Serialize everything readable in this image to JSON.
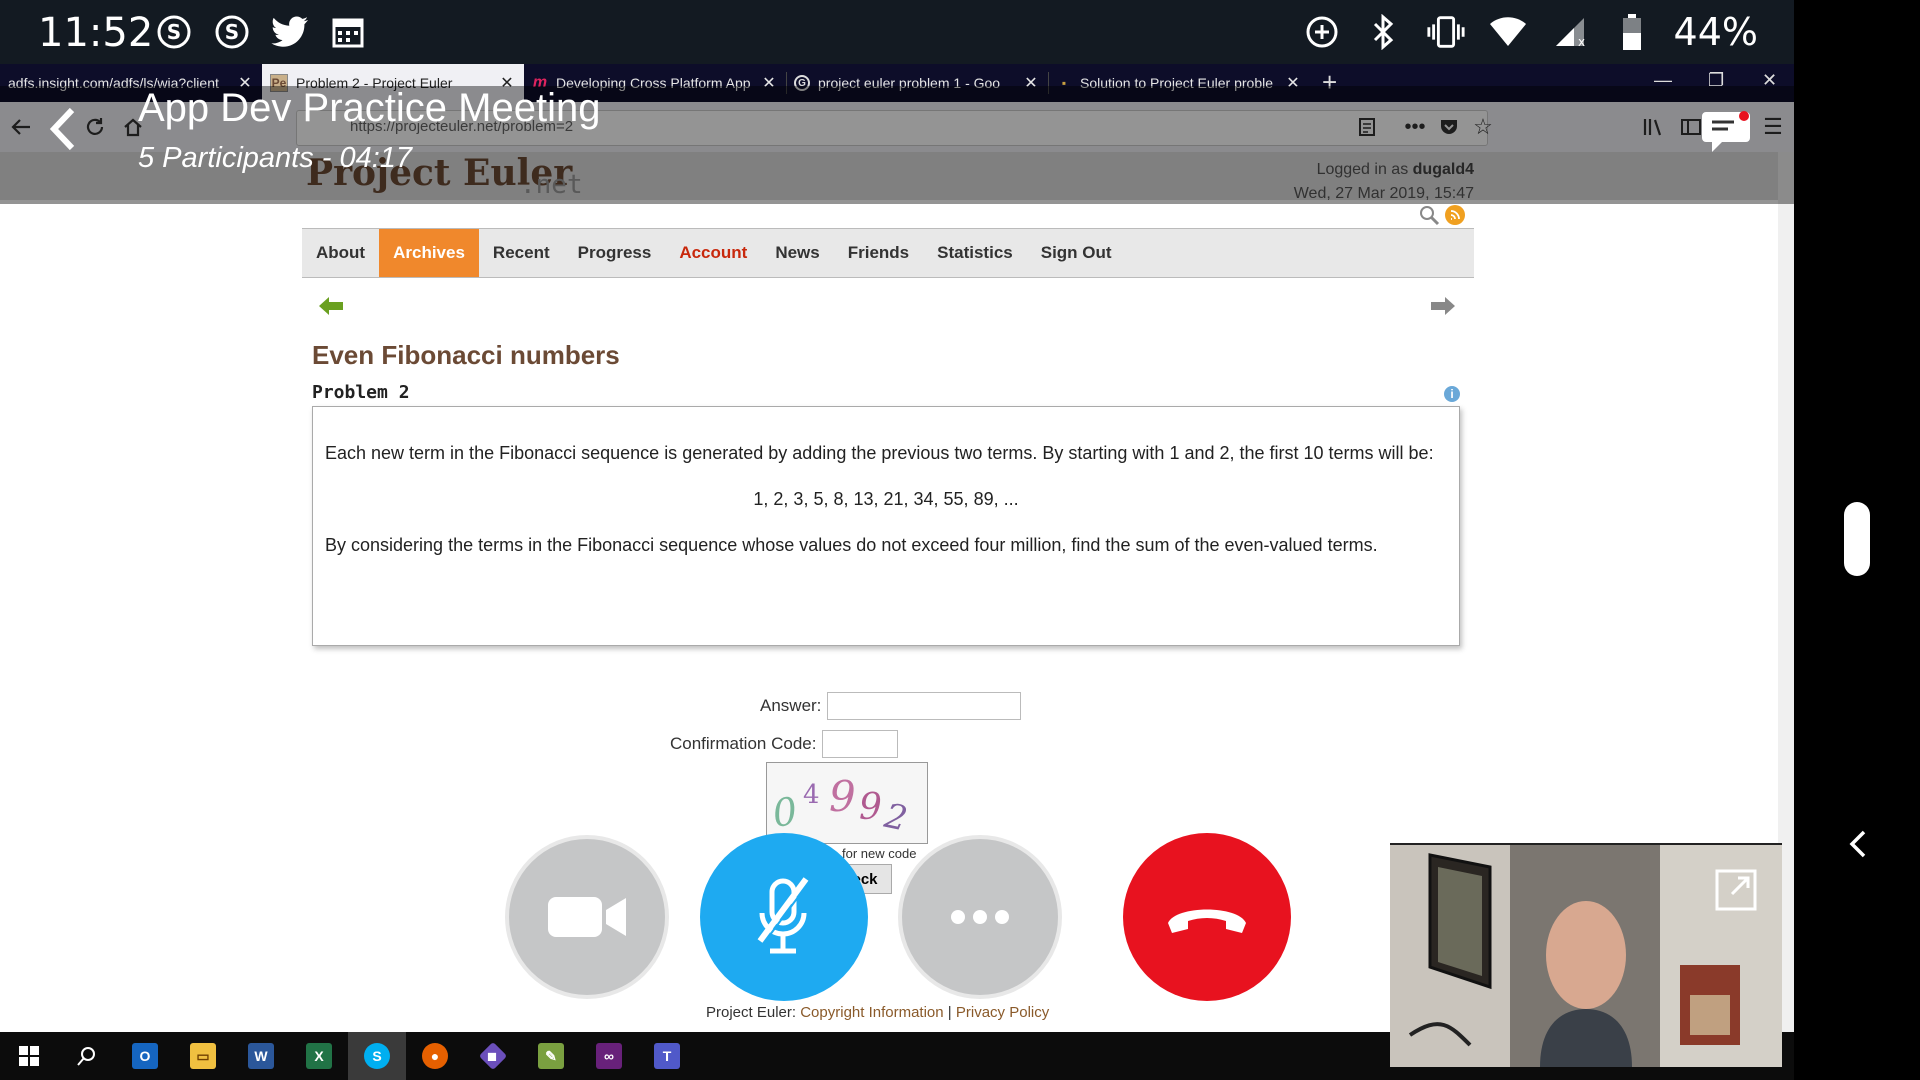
{
  "status_bar": {
    "time": "11:52",
    "battery": "44%",
    "left_icons": [
      "skype-icon",
      "skype-icon",
      "twitter-icon",
      "calendar-icon"
    ],
    "right_icons": [
      "data-saver-icon",
      "bluetooth-icon",
      "vibrate-icon",
      "wifi-icon",
      "signal-icon",
      "battery-icon"
    ]
  },
  "browser": {
    "tabs": [
      {
        "title": "adfs.insight.com/adfs/ls/wia?client",
        "icon": "none"
      },
      {
        "title": "Problem 2 - Project Euler",
        "icon": "project-euler-icon",
        "active": true
      },
      {
        "title": "Developing Cross Platform App",
        "icon": "m-icon"
      },
      {
        "title": "project euler problem 1 - Goo",
        "icon": "google-icon"
      },
      {
        "title": "Solution to Project Euler proble",
        "icon": "site-icon"
      }
    ],
    "url": "https://projecteuler.net/problem=2"
  },
  "page": {
    "logo": "Project Euler",
    "logo_suffix": ".net",
    "logged_in_prefix": "Logged in as",
    "username": "dugald4",
    "datetime": "Wed, 27 Mar 2019, 15:47",
    "nav": [
      "About",
      "Archives",
      "Recent",
      "Progress",
      "Account",
      "News",
      "Friends",
      "Statistics",
      "Sign Out"
    ],
    "active_nav": "Archives",
    "problem_title": "Even Fibonacci numbers",
    "problem_number": "Problem 2",
    "problem_text_1": "Each new term in the Fibonacci sequence is generated by adding the previous two terms. By starting with 1 and 2, the first 10 terms will be:",
    "problem_sequence": "1, 2, 3, 5, 8, 13, 21, 34, 55, 89, ...",
    "problem_text_2": "By considering the terms in the Fibonacci sequence whose values do not exceed four million, find the sum of the even-valued terms.",
    "answer_label": "Answer:",
    "confirmation_label": "Confirmation Code:",
    "captcha_text": "04992",
    "captcha_hint": "for new code",
    "check_label": "eck",
    "footer_prefix": "Project Euler:",
    "footer_copyright": "Copyright Information",
    "footer_sep": "|",
    "footer_privacy": "Privacy Policy"
  },
  "meeting": {
    "title": "App Dev Practice Meeting",
    "subtitle": "5 Participants - 04:17"
  },
  "taskbar": {
    "apps": [
      "windows-start-icon",
      "search-icon",
      "outlook-icon",
      "file-explorer-icon",
      "word-icon",
      "excel-icon",
      "skype-icon",
      "firefox-icon",
      "git-icon",
      "notepad-icon",
      "visual-studio-icon",
      "teams-icon"
    ]
  },
  "colors": {
    "pe_orange": "#f0882c",
    "pe_brown": "#6b4a35",
    "account_red": "#c8280c",
    "skype_blue": "#1eaaf1",
    "hangup_red": "#e8121f"
  }
}
